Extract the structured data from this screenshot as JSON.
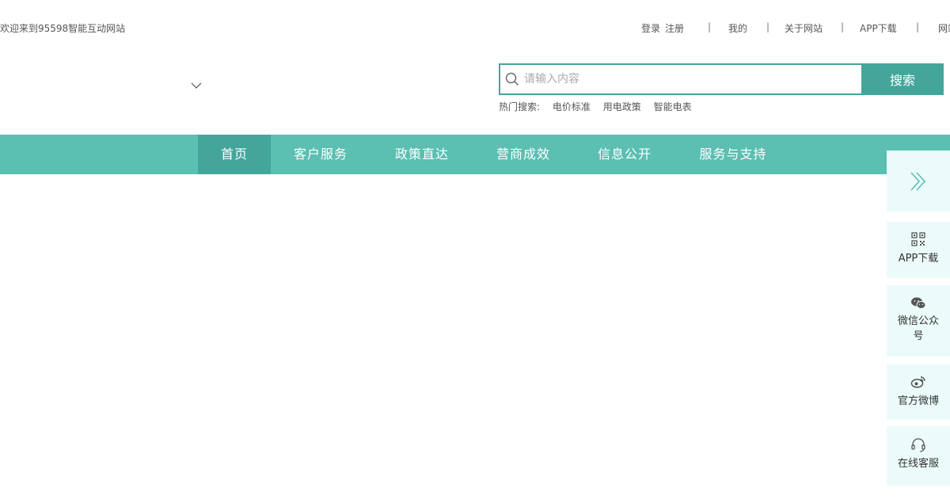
{
  "topbar": {
    "welcome": "欢迎来到95598智能互动网站",
    "links": {
      "login": "登录",
      "register": "注册",
      "sep": "|",
      "mine": "我的",
      "about": "关于网站",
      "app": "APP下载",
      "more": "网站"
    }
  },
  "search": {
    "placeholder": "请输入内容",
    "button": "搜索",
    "hot_label": "热门搜索:",
    "hot_items": [
      "电价标准",
      "用电政策",
      "智能电表"
    ]
  },
  "nav": {
    "items": [
      "首页",
      "客户服务",
      "政策直达",
      "营商成效",
      "信息公开",
      "服务与支持"
    ]
  },
  "float": {
    "app": "APP下载",
    "wechat": "微信公众号",
    "weibo": "官方微博",
    "service": "在线客服"
  },
  "colors": {
    "accent": "#44a69b",
    "nav_bg": "#5bbfb2",
    "float_bg": "#ebfbfa"
  }
}
